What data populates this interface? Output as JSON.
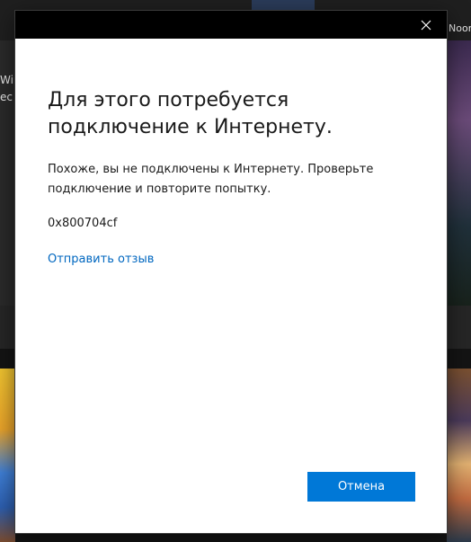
{
  "background": {
    "left_partial_text_1": "Win",
    "left_partial_text_2": "ес",
    "right_partial_text": "Noor"
  },
  "dialog": {
    "title": "Для этого потребуется подключение к Интернету.",
    "message": "Похоже, вы не подключены к Интернету. Проверьте подключение и повторите попытку.",
    "error_code": "0x800704cf",
    "feedback_link": "Отправить отзыв",
    "cancel_label": "Отмена",
    "close_icon": "close-icon"
  },
  "colors": {
    "titlebar": "#000000",
    "accent": "#0078d7",
    "link": "#0067c0",
    "text": "#1a1a1a"
  }
}
